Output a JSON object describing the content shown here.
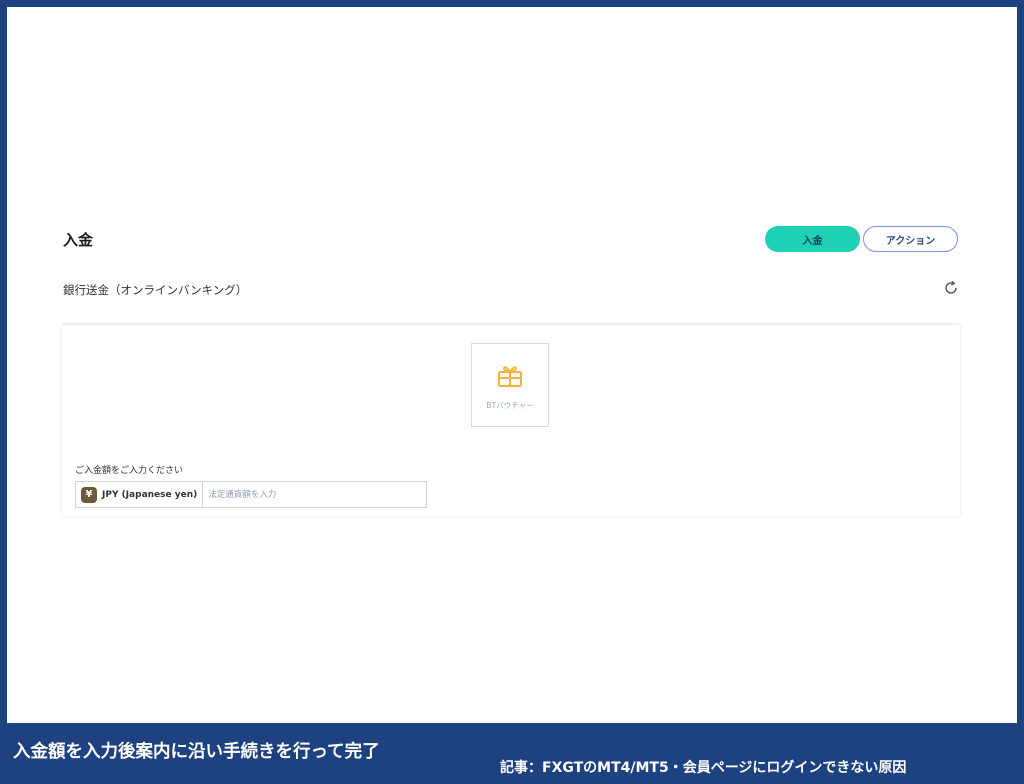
{
  "page": {
    "title": "入金",
    "buttons": {
      "deposit": "入金",
      "action": "アクション"
    },
    "subtitle": "銀行送金（オンラインバンキング）"
  },
  "payment_method": {
    "icon": "gift-voucher-icon",
    "label": "BTバウチャー"
  },
  "amount": {
    "label": "ご入金額をご入力ください",
    "currency_symbol": "¥",
    "currency": "JPY (Japanese yen)",
    "placeholder": "法定通貨額を入力"
  },
  "caption": {
    "main": "入金額を入力後案内に沿い手続きを行って完了",
    "article": "記事：FXGTのMT4/MT5・会員ページにログインできない原因"
  },
  "colors": {
    "frame": "#1e4280",
    "accent": "#1ed1b4",
    "outline": "#7b93d9",
    "voucher_icon": "#f4b13e"
  }
}
